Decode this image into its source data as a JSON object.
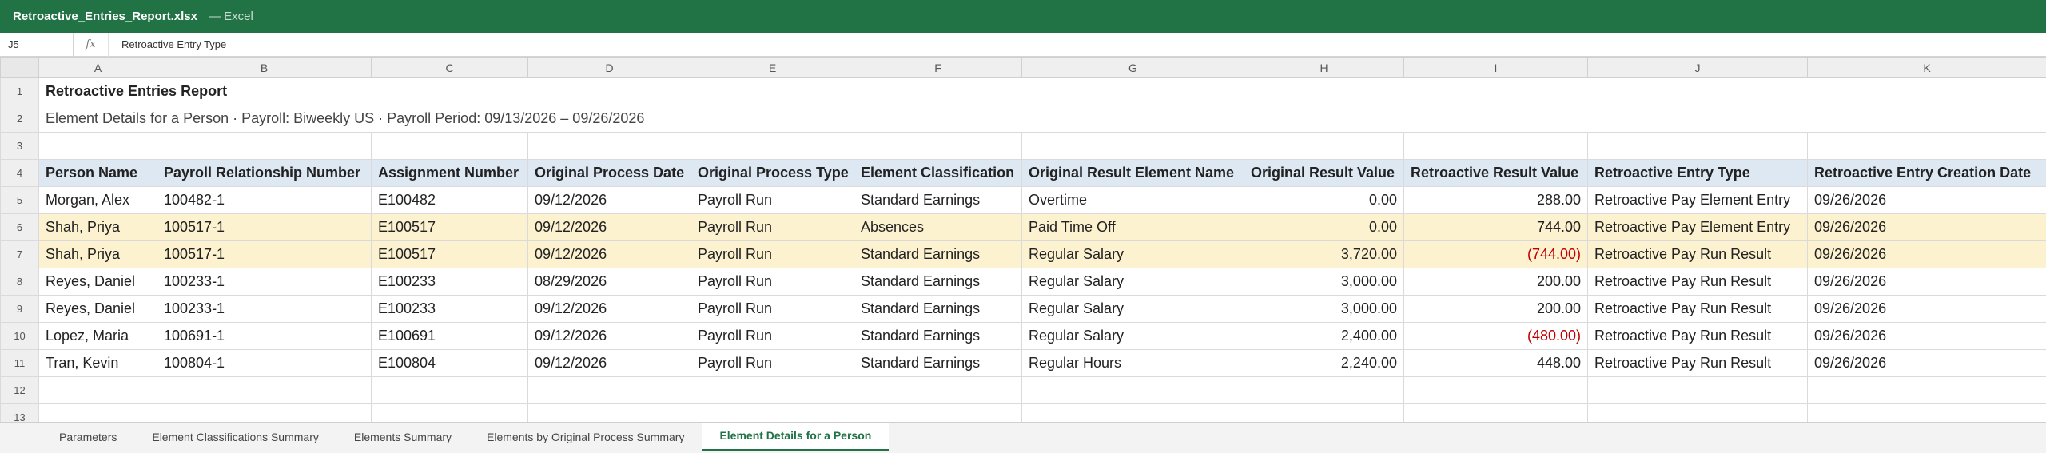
{
  "window": {
    "filename": "Retroactive_Entries_Report.xlsx",
    "app": "— Excel"
  },
  "formula_bar": {
    "cell_ref": "J5",
    "fx_label": "fx",
    "content": "Retroactive Entry Type"
  },
  "columns": [
    "A",
    "B",
    "C",
    "D",
    "E",
    "F",
    "G",
    "H",
    "I",
    "J",
    "K"
  ],
  "rows": {
    "r1": {
      "num": "1",
      "title": "Retroactive Entries Report"
    },
    "r2": {
      "num": "2",
      "subtitle": "Element Details for a Person  ·  Payroll: Biweekly US  ·  Payroll Period: 09/13/2026 – 09/26/2026"
    },
    "r3": {
      "num": "3"
    },
    "r4": {
      "num": "4",
      "headers": [
        "Person Name",
        "Payroll Relationship Number",
        "Assignment Number",
        "Original Process Date",
        "Original Process Type",
        "Element Classification",
        "Original Result Element Name",
        "Original Result Value",
        "Retroactive Result Value",
        "Retroactive Entry Type",
        "Retroactive Entry Creation Date"
      ]
    },
    "data": [
      {
        "num": "5",
        "cells": [
          "Morgan, Alex",
          "100482-1",
          "E100482",
          "09/12/2026",
          "Payroll Run",
          "Standard Earnings",
          "Overtime",
          "0.00",
          "288.00",
          "Retroactive Pay Element Entry",
          "09/26/2026"
        ]
      },
      {
        "num": "6",
        "cells": [
          "Shah, Priya",
          "100517-1",
          "E100517",
          "09/12/2026",
          "Payroll Run",
          "Absences",
          "Paid Time Off",
          "0.00",
          "744.00",
          "Retroactive Pay Element Entry",
          "09/26/2026"
        ]
      },
      {
        "num": "7",
        "cells": [
          "Shah, Priya",
          "100517-1",
          "E100517",
          "09/12/2026",
          "Payroll Run",
          "Standard Earnings",
          "Regular Salary",
          "3,720.00",
          "(744.00)",
          "Retroactive Pay Run Result",
          "09/26/2026"
        ]
      },
      {
        "num": "8",
        "cells": [
          "Reyes, Daniel",
          "100233-1",
          "E100233",
          "08/29/2026",
          "Payroll Run",
          "Standard Earnings",
          "Regular Salary",
          "3,000.00",
          "200.00",
          "Retroactive Pay Run Result",
          "09/26/2026"
        ]
      },
      {
        "num": "9",
        "cells": [
          "Reyes, Daniel",
          "100233-1",
          "E100233",
          "09/12/2026",
          "Payroll Run",
          "Standard Earnings",
          "Regular Salary",
          "3,000.00",
          "200.00",
          "Retroactive Pay Run Result",
          "09/26/2026"
        ]
      },
      {
        "num": "10",
        "cells": [
          "Lopez, Maria",
          "100691-1",
          "E100691",
          "09/12/2026",
          "Payroll Run",
          "Standard Earnings",
          "Regular Salary",
          "2,400.00",
          "(480.00)",
          "Retroactive Pay Run Result",
          "09/26/2026"
        ]
      },
      {
        "num": "11",
        "cells": [
          "Tran, Kevin",
          "100804-1",
          "E100804",
          "09/12/2026",
          "Payroll Run",
          "Standard Earnings",
          "Regular Hours",
          "2,240.00",
          "448.00",
          "Retroactive Pay Run Result",
          "09/26/2026"
        ]
      }
    ],
    "r12": {
      "num": "12"
    },
    "r13": {
      "num": "13"
    }
  },
  "sheet_tabs": [
    {
      "label": "Parameters"
    },
    {
      "label": "Element Classifications Summary"
    },
    {
      "label": "Elements Summary"
    },
    {
      "label": "Elements by Original Process Summary"
    },
    {
      "label": "Element Details for a Person"
    }
  ],
  "active_tab": "Element Details for a Person",
  "colors": {
    "accent": "#217346",
    "header_fill": "#dde8f3",
    "highlight_fill": "#fdf2d0",
    "negative": "#c00000"
  }
}
